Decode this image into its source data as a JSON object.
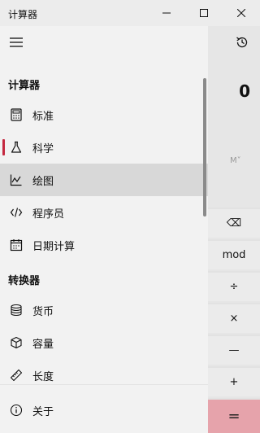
{
  "window": {
    "title": "计算器",
    "minimize_glyph": "—",
    "maximize_glyph": "☐",
    "close_glyph": "✕"
  },
  "nav": {
    "calculator_header": "计算器",
    "converter_header": "转换器",
    "items": [
      {
        "label": "标准",
        "icon": "calculator-icon"
      },
      {
        "label": "科学",
        "icon": "flask-icon",
        "active": true
      },
      {
        "label": "绘图",
        "icon": "graph-icon",
        "selected": true
      },
      {
        "label": "程序员",
        "icon": "code-icon"
      },
      {
        "label": "日期计算",
        "icon": "calendar-icon"
      }
    ],
    "converter_items": [
      {
        "label": "货币",
        "icon": "currency-icon"
      },
      {
        "label": "容量",
        "icon": "cube-icon"
      },
      {
        "label": "长度",
        "icon": "ruler-icon"
      }
    ],
    "about": {
      "label": "关于",
      "icon": "info-icon"
    }
  },
  "calculator": {
    "display": "0",
    "memory_label": "M˅",
    "keys": {
      "backspace": "⌫",
      "mod": "mod",
      "divide": "÷",
      "multiply": "×",
      "minus": "—",
      "plus": "+",
      "equals": "="
    }
  },
  "colors": {
    "accent": "#c4283f",
    "equals_bg": "#e6a3ab",
    "selected_bg": "#d8d8d8"
  }
}
